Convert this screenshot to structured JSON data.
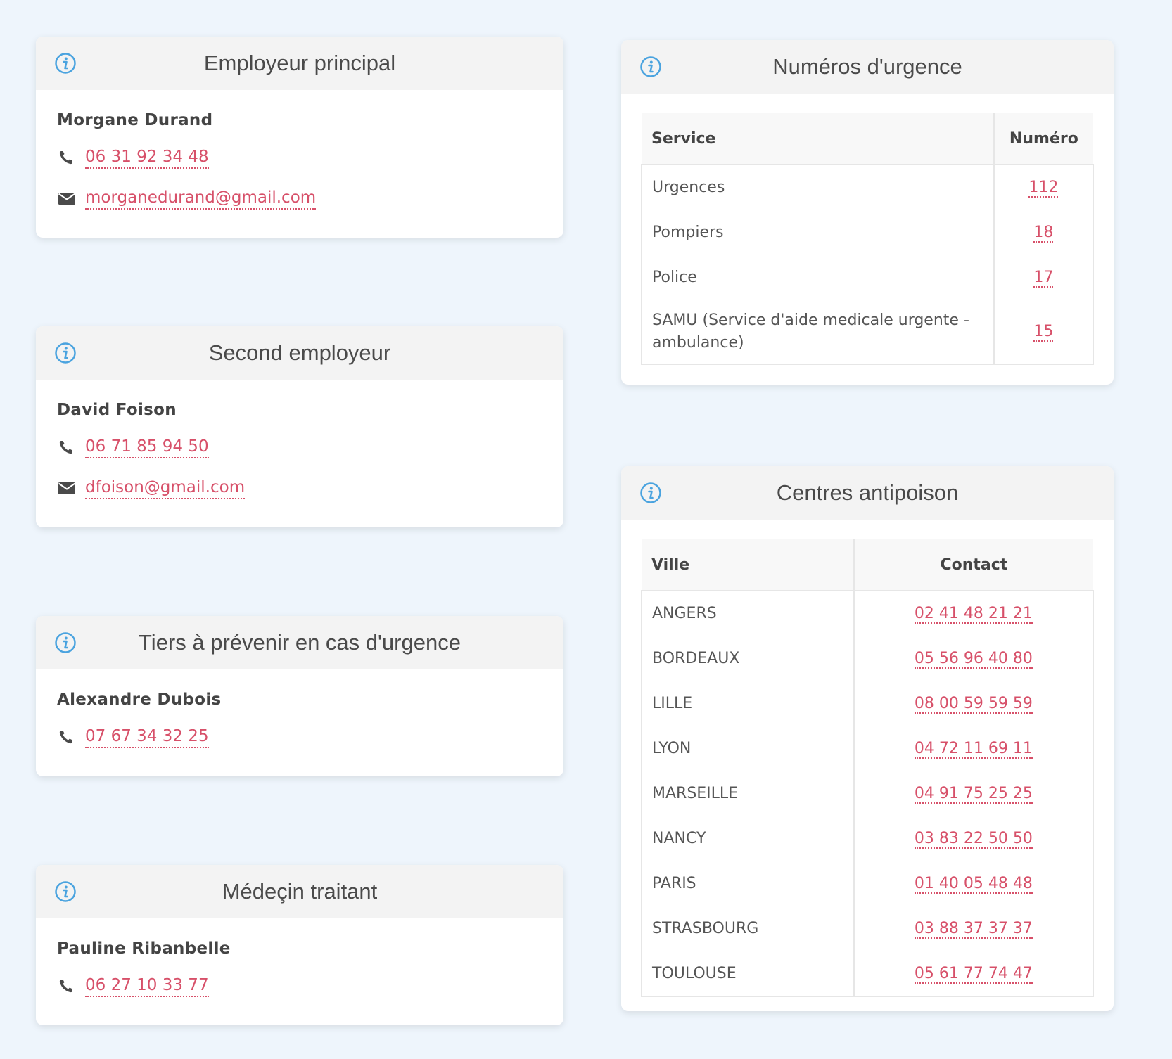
{
  "employeur_principal": {
    "title": "Employeur principal",
    "name": "Morgane Durand",
    "phone": "06 31 92 34 48",
    "email": "morganedurand@gmail.com"
  },
  "second_employeur": {
    "title": "Second employeur",
    "name": "David Foison",
    "phone": "06 71 85 94 50",
    "email": "dfoison@gmail.com"
  },
  "tiers": {
    "title": "Tiers à prévenir en cas d'urgence",
    "name": "Alexandre Dubois",
    "phone": "07 67 34 32 25"
  },
  "medecin": {
    "title": "Médeçin traitant",
    "name": "Pauline Ribanbelle",
    "phone": "06 27 10 33 77"
  },
  "urgence": {
    "title": "Numéros d'urgence",
    "col_service": "Service",
    "col_numero": "Numéro",
    "rows": [
      {
        "service": "Urgences",
        "numero": "112"
      },
      {
        "service": "Pompiers",
        "numero": "18"
      },
      {
        "service": "Police",
        "numero": "17"
      },
      {
        "service": "SAMU (Service d'aide medicale urgente - ambulance)",
        "numero": "15"
      }
    ]
  },
  "antipoison": {
    "title": "Centres antipoison",
    "col_ville": "Ville",
    "col_contact": "Contact",
    "rows": [
      {
        "ville": "ANGERS",
        "contact": "02 41 48 21 21"
      },
      {
        "ville": "BORDEAUX",
        "contact": "05 56 96 40 80"
      },
      {
        "ville": "LILLE",
        "contact": "08 00 59 59 59"
      },
      {
        "ville": "LYON",
        "contact": "04 72 11 69 11"
      },
      {
        "ville": "MARSEILLE",
        "contact": "04 91 75 25 25"
      },
      {
        "ville": "NANCY",
        "contact": "03 83 22 50 50"
      },
      {
        "ville": "PARIS",
        "contact": "01 40 05 48 48"
      },
      {
        "ville": "STRASBOURG",
        "contact": "03 88 37 37 37"
      },
      {
        "ville": "TOULOUSE",
        "contact": "05 61 77 74 47"
      }
    ]
  },
  "icons": {
    "info": "info-circle-icon",
    "phone": "phone-icon",
    "email": "envelope-icon"
  },
  "colors": {
    "background": "#eef5fc",
    "link": "#d75069",
    "info_icon": "#4aa3df",
    "header_bg": "#f3f3f3"
  }
}
